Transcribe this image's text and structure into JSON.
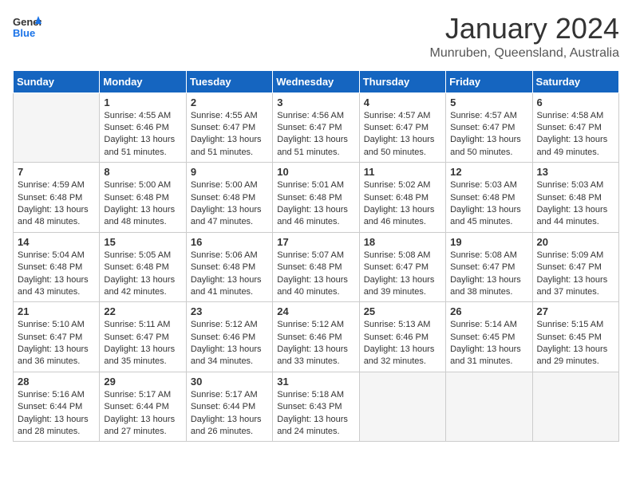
{
  "header": {
    "logo_general": "General",
    "logo_blue": "Blue",
    "month": "January 2024",
    "location": "Munruben, Queensland, Australia"
  },
  "weekdays": [
    "Sunday",
    "Monday",
    "Tuesday",
    "Wednesday",
    "Thursday",
    "Friday",
    "Saturday"
  ],
  "weeks": [
    [
      {
        "day": "",
        "details": ""
      },
      {
        "day": "1",
        "details": "Sunrise: 4:55 AM\nSunset: 6:46 PM\nDaylight: 13 hours\nand 51 minutes."
      },
      {
        "day": "2",
        "details": "Sunrise: 4:55 AM\nSunset: 6:47 PM\nDaylight: 13 hours\nand 51 minutes."
      },
      {
        "day": "3",
        "details": "Sunrise: 4:56 AM\nSunset: 6:47 PM\nDaylight: 13 hours\nand 51 minutes."
      },
      {
        "day": "4",
        "details": "Sunrise: 4:57 AM\nSunset: 6:47 PM\nDaylight: 13 hours\nand 50 minutes."
      },
      {
        "day": "5",
        "details": "Sunrise: 4:57 AM\nSunset: 6:47 PM\nDaylight: 13 hours\nand 50 minutes."
      },
      {
        "day": "6",
        "details": "Sunrise: 4:58 AM\nSunset: 6:47 PM\nDaylight: 13 hours\nand 49 minutes."
      }
    ],
    [
      {
        "day": "7",
        "details": "Sunrise: 4:59 AM\nSunset: 6:48 PM\nDaylight: 13 hours\nand 48 minutes."
      },
      {
        "day": "8",
        "details": "Sunrise: 5:00 AM\nSunset: 6:48 PM\nDaylight: 13 hours\nand 48 minutes."
      },
      {
        "day": "9",
        "details": "Sunrise: 5:00 AM\nSunset: 6:48 PM\nDaylight: 13 hours\nand 47 minutes."
      },
      {
        "day": "10",
        "details": "Sunrise: 5:01 AM\nSunset: 6:48 PM\nDaylight: 13 hours\nand 46 minutes."
      },
      {
        "day": "11",
        "details": "Sunrise: 5:02 AM\nSunset: 6:48 PM\nDaylight: 13 hours\nand 46 minutes."
      },
      {
        "day": "12",
        "details": "Sunrise: 5:03 AM\nSunset: 6:48 PM\nDaylight: 13 hours\nand 45 minutes."
      },
      {
        "day": "13",
        "details": "Sunrise: 5:03 AM\nSunset: 6:48 PM\nDaylight: 13 hours\nand 44 minutes."
      }
    ],
    [
      {
        "day": "14",
        "details": "Sunrise: 5:04 AM\nSunset: 6:48 PM\nDaylight: 13 hours\nand 43 minutes."
      },
      {
        "day": "15",
        "details": "Sunrise: 5:05 AM\nSunset: 6:48 PM\nDaylight: 13 hours\nand 42 minutes."
      },
      {
        "day": "16",
        "details": "Sunrise: 5:06 AM\nSunset: 6:48 PM\nDaylight: 13 hours\nand 41 minutes."
      },
      {
        "day": "17",
        "details": "Sunrise: 5:07 AM\nSunset: 6:48 PM\nDaylight: 13 hours\nand 40 minutes."
      },
      {
        "day": "18",
        "details": "Sunrise: 5:08 AM\nSunset: 6:47 PM\nDaylight: 13 hours\nand 39 minutes."
      },
      {
        "day": "19",
        "details": "Sunrise: 5:08 AM\nSunset: 6:47 PM\nDaylight: 13 hours\nand 38 minutes."
      },
      {
        "day": "20",
        "details": "Sunrise: 5:09 AM\nSunset: 6:47 PM\nDaylight: 13 hours\nand 37 minutes."
      }
    ],
    [
      {
        "day": "21",
        "details": "Sunrise: 5:10 AM\nSunset: 6:47 PM\nDaylight: 13 hours\nand 36 minutes."
      },
      {
        "day": "22",
        "details": "Sunrise: 5:11 AM\nSunset: 6:47 PM\nDaylight: 13 hours\nand 35 minutes."
      },
      {
        "day": "23",
        "details": "Sunrise: 5:12 AM\nSunset: 6:46 PM\nDaylight: 13 hours\nand 34 minutes."
      },
      {
        "day": "24",
        "details": "Sunrise: 5:12 AM\nSunset: 6:46 PM\nDaylight: 13 hours\nand 33 minutes."
      },
      {
        "day": "25",
        "details": "Sunrise: 5:13 AM\nSunset: 6:46 PM\nDaylight: 13 hours\nand 32 minutes."
      },
      {
        "day": "26",
        "details": "Sunrise: 5:14 AM\nSunset: 6:45 PM\nDaylight: 13 hours\nand 31 minutes."
      },
      {
        "day": "27",
        "details": "Sunrise: 5:15 AM\nSunset: 6:45 PM\nDaylight: 13 hours\nand 29 minutes."
      }
    ],
    [
      {
        "day": "28",
        "details": "Sunrise: 5:16 AM\nSunset: 6:44 PM\nDaylight: 13 hours\nand 28 minutes."
      },
      {
        "day": "29",
        "details": "Sunrise: 5:17 AM\nSunset: 6:44 PM\nDaylight: 13 hours\nand 27 minutes."
      },
      {
        "day": "30",
        "details": "Sunrise: 5:17 AM\nSunset: 6:44 PM\nDaylight: 13 hours\nand 26 minutes."
      },
      {
        "day": "31",
        "details": "Sunrise: 5:18 AM\nSunset: 6:43 PM\nDaylight: 13 hours\nand 24 minutes."
      },
      {
        "day": "",
        "details": ""
      },
      {
        "day": "",
        "details": ""
      },
      {
        "day": "",
        "details": ""
      }
    ]
  ]
}
